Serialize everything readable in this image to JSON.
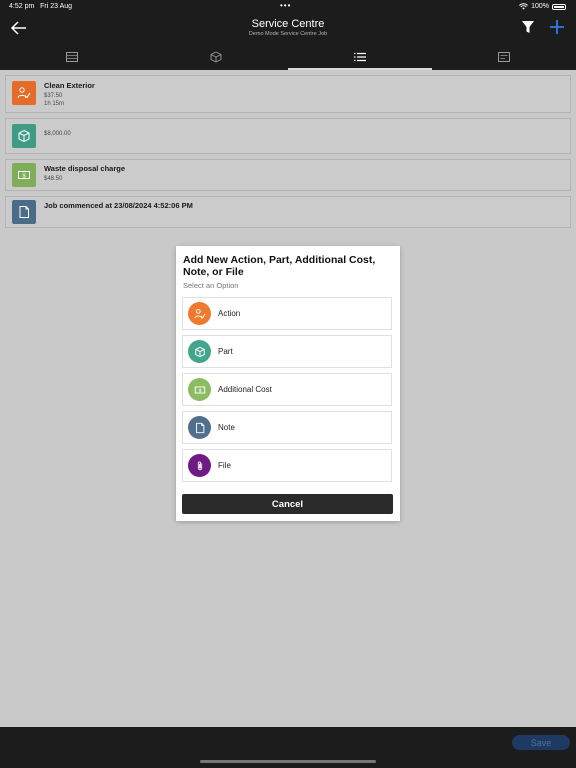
{
  "status": {
    "time": "4:52 pm",
    "date": "Fri 23 Aug",
    "battery": "100%"
  },
  "header": {
    "title": "Service Centre",
    "subtitle": "Demo Mode Service Centre Job"
  },
  "tabs": [
    {
      "icon": "details-icon"
    },
    {
      "icon": "box-icon"
    },
    {
      "icon": "list-icon",
      "active": true
    },
    {
      "icon": "notes-icon"
    }
  ],
  "items": [
    {
      "name": "Clean Exterior",
      "price": "$37.50",
      "duration": "1h 15m",
      "color": "#e56b28",
      "icon": "action-icon"
    },
    {
      "name": "",
      "price": "$8,000.00",
      "color": "#3f9b85",
      "icon": "part-icon"
    },
    {
      "name": "Waste disposal charge",
      "price": "$48.50",
      "color": "#7fae58",
      "icon": "cost-icon"
    },
    {
      "name": "Job commenced at 23/08/2024 4:52:06 PM",
      "color": "#4c6b88",
      "icon": "note-icon"
    }
  ],
  "modal": {
    "title": "Add New Action, Part, Additional Cost, Note, or File",
    "subtitle": "Select an Option",
    "options": [
      {
        "label": "Action",
        "color": "#ef7a2d",
        "icon": "action-icon"
      },
      {
        "label": "Part",
        "color": "#43a68c",
        "icon": "part-icon"
      },
      {
        "label": "Additional Cost",
        "color": "#8cbc62",
        "icon": "cost-icon"
      },
      {
        "label": "Note",
        "color": "#4f6f8d",
        "icon": "note-icon"
      },
      {
        "label": "File",
        "color": "#6f1a82",
        "icon": "attachment-icon"
      }
    ],
    "cancel_label": "Cancel"
  },
  "footer": {
    "save_label": "Save"
  }
}
